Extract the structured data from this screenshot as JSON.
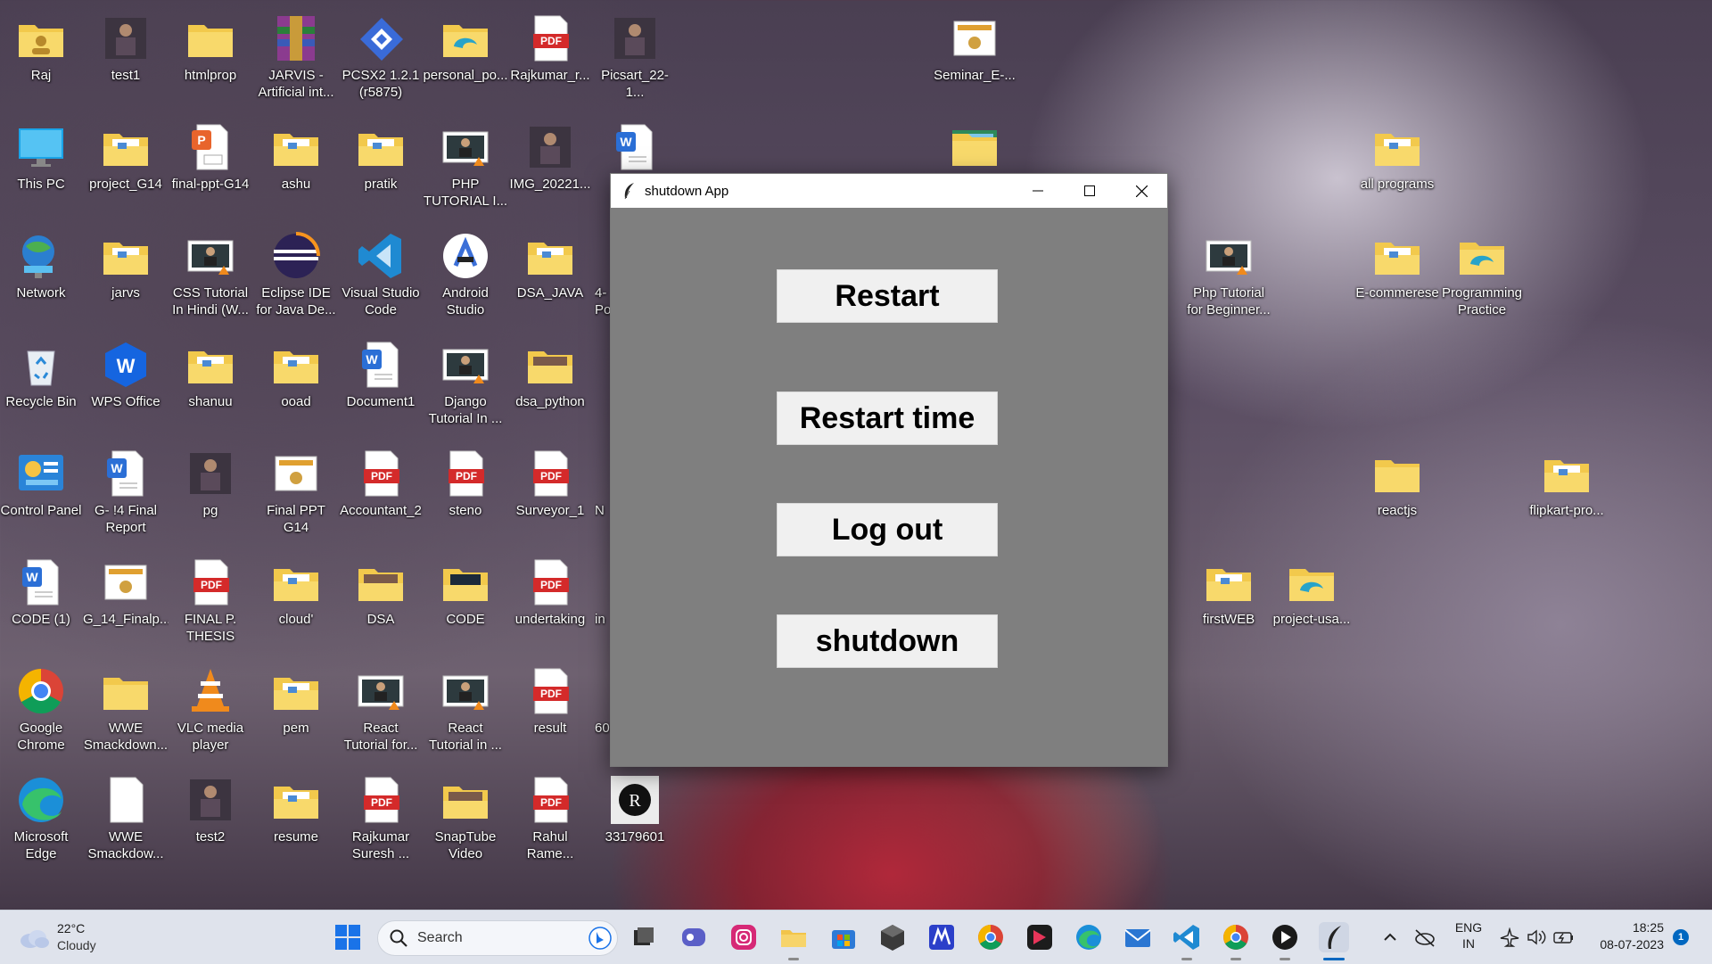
{
  "desktop": {
    "icons": [
      {
        "label": "Raj"
      },
      {
        "label": "test1"
      },
      {
        "label": "htmlprop"
      },
      {
        "label": "JARVIS -\nArtificial int..."
      },
      {
        "label": "PCSX2 1.2.1\n(r5875)"
      },
      {
        "label": "personal_po..."
      },
      {
        "label": "Rajkumar_r..."
      },
      {
        "label": "Picsart_22-1..."
      },
      {
        "label": "Seminar_E-..."
      },
      {
        "label": "This PC"
      },
      {
        "label": "project_G14"
      },
      {
        "label": "final-ppt-G14"
      },
      {
        "label": "ashu"
      },
      {
        "label": "pratik"
      },
      {
        "label": "PHP\nTUTORIAL I..."
      },
      {
        "label": "IMG_20221..."
      },
      {
        "label": ""
      },
      {
        "label": ""
      },
      {
        "label": ""
      },
      {
        "label": "all programs"
      },
      {
        "label": "Network"
      },
      {
        "label": "jarvs"
      },
      {
        "label": "CSS Tutorial\nIn Hindi (W..."
      },
      {
        "label": "Eclipse IDE\nfor Java De..."
      },
      {
        "label": "Visual Studio\nCode"
      },
      {
        "label": "Android\nStudio"
      },
      {
        "label": "DSA_JAVA"
      },
      {
        "label": "4-\nPo"
      },
      {
        "label": "Php Tutorial\nfor Beginner..."
      },
      {
        "label": "E-commerese"
      },
      {
        "label": "Programming\nPractice"
      },
      {
        "label": "Recycle Bin"
      },
      {
        "label": "WPS Office"
      },
      {
        "label": "shanuu"
      },
      {
        "label": "ooad"
      },
      {
        "label": "Document1"
      },
      {
        "label": "Django\nTutorial In ..."
      },
      {
        "label": "dsa_python"
      },
      {
        "label": "Control Panel"
      },
      {
        "label": "G- !4 Final\nReport"
      },
      {
        "label": "pg"
      },
      {
        "label": "Final PPT G14"
      },
      {
        "label": "Accountant_2"
      },
      {
        "label": "steno"
      },
      {
        "label": "Surveyor_1"
      },
      {
        "label": "N"
      },
      {
        "label": "reactjs"
      },
      {
        "label": "flipkart-pro..."
      },
      {
        "label": "CODE (1)"
      },
      {
        "label": "G_14_Finalp..."
      },
      {
        "label": "FINAL P.\nTHESIS"
      },
      {
        "label": "cloud'"
      },
      {
        "label": "DSA"
      },
      {
        "label": "CODE"
      },
      {
        "label": "undertaking"
      },
      {
        "label": "in"
      },
      {
        "label": "firstWEB"
      },
      {
        "label": "project-usa..."
      },
      {
        "label": "Google\nChrome"
      },
      {
        "label": "WWE\nSmackdown..."
      },
      {
        "label": "VLC media\nplayer"
      },
      {
        "label": "pem"
      },
      {
        "label": "React\nTutorial for..."
      },
      {
        "label": "React\nTutorial in ..."
      },
      {
        "label": "result"
      },
      {
        "label": "60"
      },
      {
        "label": "Microsoft\nEdge"
      },
      {
        "label": "WWE\nSmackdow..."
      },
      {
        "label": "test2"
      },
      {
        "label": "resume"
      },
      {
        "label": "Rajkumar\nSuresh ..."
      },
      {
        "label": "SnapTube\nVideo"
      },
      {
        "label": "Rahul\nRame..."
      },
      {
        "label": "33179601"
      }
    ]
  },
  "app_window": {
    "title": "shutdown App",
    "buttons": {
      "restart": "Restart",
      "restart_time": "Restart time",
      "logout": "Log out",
      "shutdown": "shutdown"
    }
  },
  "taskbar": {
    "weather": {
      "temp": "22°C",
      "condition": "Cloudy"
    },
    "search_placeholder": "Search",
    "language": {
      "line1": "ENG",
      "line2": "IN"
    },
    "time": "18:25",
    "date": "08-07-2023",
    "notification_count": "1"
  },
  "colors": {
    "window_bg": "#7f7f7f",
    "button_bg": "#f0f0f0",
    "taskbar_bg": "#dfe3ec",
    "accent": "#0067c0"
  }
}
